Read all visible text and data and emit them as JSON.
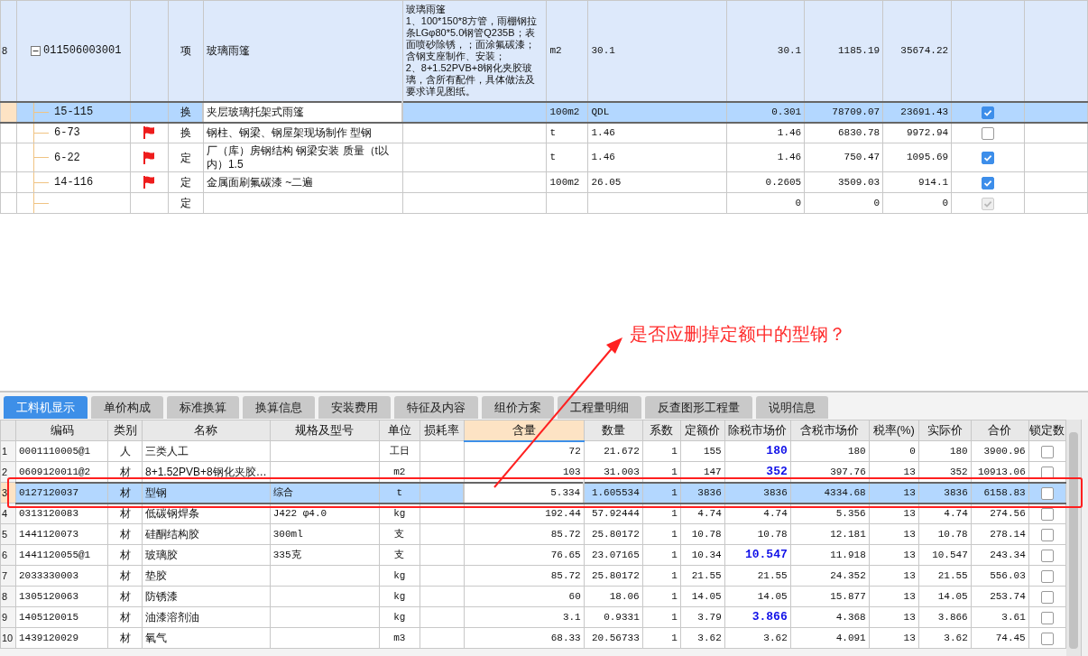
{
  "upper_table": {
    "rows": [
      {
        "kind": "item",
        "number": "8",
        "code": "011506003001",
        "expanded": true,
        "type": "项",
        "name": "玻璃雨篷",
        "description": "玻璃雨篷\n1、100*150*8方管，雨棚钢拉条LGφ80*5.0钢管Q235B；表面喷砂除锈，；面涂氟碳漆；含钢支座制作、安装；\n2、8+1.52PVB+8钢化夹胶玻璃，含所有配件，具体做法及要求详见图纸。",
        "unit": "m2",
        "expression": "30.1",
        "quantity": "30.1",
        "unit_price": "1185.19",
        "total": "35674.22",
        "selected": false,
        "children": [
          {
            "kind": "quota",
            "code": "15-115",
            "flag": false,
            "type": "换",
            "name": "夹层玻璃托架式雨篷",
            "unit": "100m2",
            "expression": "QDL",
            "quantity": "0.301",
            "unit_price": "78709.07",
            "total": "23691.43",
            "checked": true,
            "disabled": false,
            "selected": true
          },
          {
            "kind": "quota",
            "code": "6-73",
            "flag": true,
            "type": "换",
            "name": "钢柱、钢梁、钢屋架现场制作 型钢",
            "unit": "t",
            "expression": "1.46",
            "quantity": "1.46",
            "unit_price": "6830.78",
            "total": "9972.94",
            "checked": false,
            "disabled": false,
            "selected": false
          },
          {
            "kind": "quota",
            "code": "6-22",
            "flag": true,
            "type": "定",
            "name": "厂（库）房钢结构 钢梁安装 质量（t以内）1.5",
            "unit": "t",
            "expression": "1.46",
            "quantity": "1.46",
            "unit_price": "750.47",
            "total": "1095.69",
            "checked": true,
            "disabled": false,
            "selected": false
          },
          {
            "kind": "quota",
            "code": "14-116",
            "flag": true,
            "type": "定",
            "name": "金属面刷氟碳漆 ~二遍",
            "unit": "100m2",
            "expression": "26.05",
            "quantity": "0.2605",
            "unit_price": "3509.03",
            "total": "914.1",
            "checked": true,
            "disabled": false,
            "selected": false
          },
          {
            "kind": "quota",
            "flag": false,
            "type": "定",
            "quantity": "0",
            "unit_price": "0",
            "total": "0",
            "checked": true,
            "disabled": true,
            "selected": false
          }
        ]
      }
    ]
  },
  "annotation": {
    "text": "是否应删掉定额中的型钢？"
  },
  "lower_panel": {
    "tabs": [
      {
        "label": "工料机显示",
        "selected": true
      },
      {
        "label": "单价构成",
        "selected": false
      },
      {
        "label": "标准换算",
        "selected": false
      },
      {
        "label": "换算信息",
        "selected": false
      },
      {
        "label": "安装费用",
        "selected": false
      },
      {
        "label": "特征及内容",
        "selected": false
      },
      {
        "label": "组价方案",
        "selected": false
      },
      {
        "label": "工程量明细",
        "selected": false
      },
      {
        "label": "反查图形工程量",
        "selected": false
      },
      {
        "label": "说明信息",
        "selected": false
      }
    ],
    "columns": [
      {
        "label": "编码",
        "selected": false
      },
      {
        "label": "类别",
        "selected": false
      },
      {
        "label": "名称",
        "selected": false
      },
      {
        "label": "规格及型号",
        "selected": false
      },
      {
        "label": "单位",
        "selected": false
      },
      {
        "label": "损耗率",
        "selected": false
      },
      {
        "label": "含量",
        "selected": true
      },
      {
        "label": "数量",
        "selected": false
      },
      {
        "label": "系数",
        "selected": false
      },
      {
        "label": "定额价",
        "selected": false
      },
      {
        "label": "除税市场价",
        "selected": false
      },
      {
        "label": "含税市场价",
        "selected": false
      },
      {
        "label": "税率(%)",
        "selected": false
      },
      {
        "label": "实际价",
        "selected": false
      },
      {
        "label": "合价",
        "selected": false
      },
      {
        "label": "锁定数",
        "selected": false
      }
    ],
    "rows": [
      {
        "number": "1",
        "code": "0001110005@1",
        "category": "人",
        "name": "三类人工",
        "unit": "工日",
        "content": "72",
        "quantity": "21.672",
        "coefficient": "1",
        "quota_price": "155",
        "market_price_ex_tax": "180",
        "market_price_inc_tax": "180",
        "tax_rate": "0",
        "actual_price": "180",
        "total_price": "3900.96",
        "emphasized": true,
        "locked": false,
        "selected": false
      },
      {
        "number": "2",
        "code": "0609120011@2",
        "category": "材",
        "name": "8+1.52PVB+8钢化夹胶…",
        "unit": "m2",
        "content": "103",
        "quantity": "31.003",
        "coefficient": "1",
        "quota_price": "147",
        "market_price_ex_tax": "352",
        "market_price_inc_tax": "397.76",
        "tax_rate": "13",
        "actual_price": "352",
        "total_price": "10913.06",
        "emphasized": true,
        "locked": false,
        "selected": false
      },
      {
        "number": "3",
        "code": "0127120037",
        "category": "材",
        "name": "型钢",
        "spec": "综合",
        "unit": "t",
        "content": "5.334",
        "quantity": "1.605534",
        "coefficient": "1",
        "quota_price": "3836",
        "market_price_ex_tax": "3836",
        "market_price_inc_tax": "4334.68",
        "tax_rate": "13",
        "actual_price": "3836",
        "total_price": "6158.83",
        "emphasized": false,
        "locked": false,
        "selected": true
      },
      {
        "number": "4",
        "code": "0313120083",
        "category": "材",
        "name": "低碳钢焊条",
        "spec": "J422 φ4.0",
        "unit": "kg",
        "content": "192.44",
        "quantity": "57.92444",
        "coefficient": "1",
        "quota_price": "4.74",
        "market_price_ex_tax": "4.74",
        "market_price_inc_tax": "5.356",
        "tax_rate": "13",
        "actual_price": "4.74",
        "total_price": "274.56",
        "emphasized": false,
        "locked": false,
        "selected": false
      },
      {
        "number": "5",
        "code": "1441120073",
        "category": "材",
        "name": "硅酮结构胶",
        "spec": "300ml",
        "unit": "支",
        "content": "85.72",
        "quantity": "25.80172",
        "coefficient": "1",
        "quota_price": "10.78",
        "market_price_ex_tax": "10.78",
        "market_price_inc_tax": "12.181",
        "tax_rate": "13",
        "actual_price": "10.78",
        "total_price": "278.14",
        "emphasized": false,
        "locked": false,
        "selected": false
      },
      {
        "number": "6",
        "code": "1441120055@1",
        "category": "材",
        "name": "玻璃胶",
        "spec": "335克",
        "unit": "支",
        "content": "76.65",
        "quantity": "23.07165",
        "coefficient": "1",
        "quota_price": "10.34",
        "market_price_ex_tax": "10.547",
        "market_price_inc_tax": "11.918",
        "tax_rate": "13",
        "actual_price": "10.547",
        "total_price": "243.34",
        "emphasized": true,
        "locked": false,
        "selected": false
      },
      {
        "number": "7",
        "code": "2033330003",
        "category": "材",
        "name": "垫胶",
        "unit": "kg",
        "content": "85.72",
        "quantity": "25.80172",
        "coefficient": "1",
        "quota_price": "21.55",
        "market_price_ex_tax": "21.55",
        "market_price_inc_tax": "24.352",
        "tax_rate": "13",
        "actual_price": "21.55",
        "total_price": "556.03",
        "emphasized": false,
        "locked": false,
        "selected": false
      },
      {
        "number": "8",
        "code": "1305120063",
        "category": "材",
        "name": "防锈漆",
        "unit": "kg",
        "content": "60",
        "quantity": "18.06",
        "coefficient": "1",
        "quota_price": "14.05",
        "market_price_ex_tax": "14.05",
        "market_price_inc_tax": "15.877",
        "tax_rate": "13",
        "actual_price": "14.05",
        "total_price": "253.74",
        "emphasized": false,
        "locked": false,
        "selected": false
      },
      {
        "number": "9",
        "code": "1405120015",
        "category": "材",
        "name": "油漆溶剂油",
        "unit": "kg",
        "content": "3.1",
        "quantity": "0.9331",
        "coefficient": "1",
        "quota_price": "3.79",
        "market_price_ex_tax": "3.866",
        "market_price_inc_tax": "4.368",
        "tax_rate": "13",
        "actual_price": "3.866",
        "total_price": "3.61",
        "emphasized": true,
        "locked": false,
        "selected": false
      },
      {
        "number": "10",
        "code": "1439120029",
        "category": "材",
        "name": "氧气",
        "unit": "m3",
        "content": "68.33",
        "quantity": "20.56733",
        "coefficient": "1",
        "quota_price": "3.62",
        "market_price_ex_tax": "3.62",
        "market_price_inc_tax": "4.091",
        "tax_rate": "13",
        "actual_price": "3.62",
        "total_price": "74.45",
        "emphasized": false,
        "locked": false,
        "selected": false
      }
    ]
  }
}
